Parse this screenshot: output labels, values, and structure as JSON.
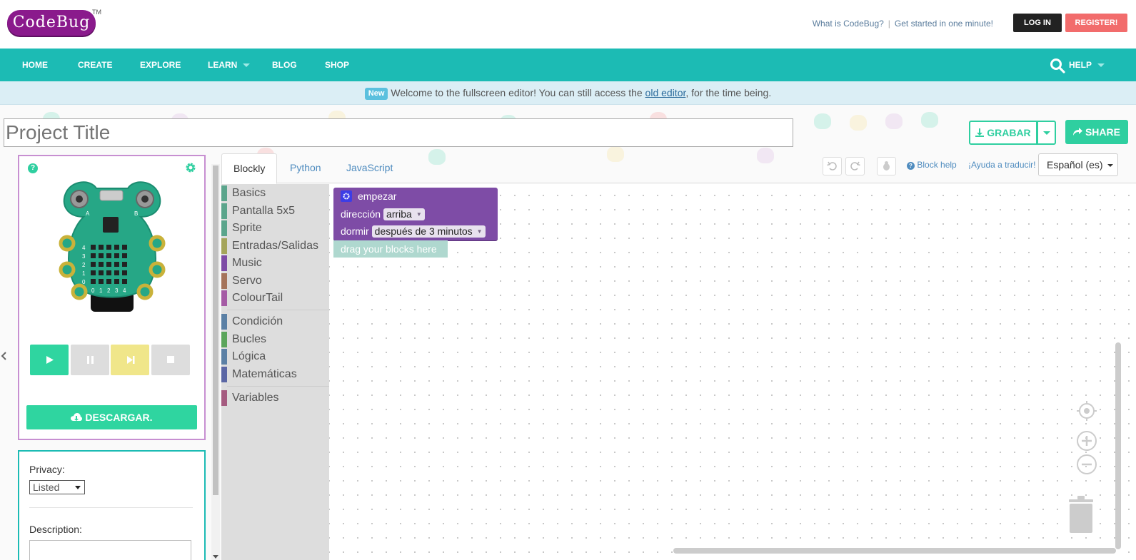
{
  "header": {
    "logo_text": "CodeBug",
    "trademark": "TM",
    "links": [
      "What is CodeBug?",
      "Get started in one minute!"
    ],
    "login_label": "LOG IN",
    "register_label": "REGISTER!"
  },
  "nav": {
    "items": [
      "HOME",
      "CREATE",
      "EXPLORE",
      "LEARN",
      "BLOG",
      "SHOP"
    ],
    "help_label": "HELP"
  },
  "banner": {
    "badge": "New",
    "text_before": "Welcome to the fullscreen editor! You can still access the ",
    "link": "old editor",
    "text_after": ", for the time being."
  },
  "project": {
    "title_placeholder": "Project Title",
    "grabar_label": "GRABAR",
    "share_label": "SHARE"
  },
  "simulator": {
    "button_a": "A",
    "button_b": "B",
    "row_labels": [
      "4",
      "3",
      "2",
      "1",
      "0"
    ],
    "col_labels": [
      "0",
      "1",
      "2",
      "3",
      "4"
    ],
    "download_label": "DESCARGAR."
  },
  "info": {
    "privacy_label": "Privacy:",
    "privacy_value": "Listed",
    "description_label": "Description:"
  },
  "editor": {
    "tabs": [
      "Blockly",
      "Python",
      "JavaScript"
    ],
    "active_tab": "Blockly",
    "block_help": "Block help",
    "ayuda": "¡Ayuda a traducir!",
    "language": "Español (es)"
  },
  "toolbox": {
    "group1": [
      {
        "label": "Basics",
        "color": "#5ba58c"
      },
      {
        "label": "Pantalla 5x5",
        "color": "#5ba58c"
      },
      {
        "label": "Sprite",
        "color": "#5ba58c"
      },
      {
        "label": "Entradas/Salidas",
        "color": "#a5a55b"
      },
      {
        "label": "Music",
        "color": "#7e4ca6"
      },
      {
        "label": "Servo",
        "color": "#a5745b"
      },
      {
        "label": "ColourTail",
        "color": "#a55ba5"
      }
    ],
    "group2": [
      {
        "label": "Condición",
        "color": "#5b80a5"
      },
      {
        "label": "Bucles",
        "color": "#5ba55b"
      },
      {
        "label": "Lógica",
        "color": "#5b80a5"
      },
      {
        "label": "Matemáticas",
        "color": "#5b67a5"
      }
    ],
    "group3": [
      {
        "label": "Variables",
        "color": "#a55b80"
      }
    ]
  },
  "workspace": {
    "block_title": "empezar",
    "direction_label": "dirección",
    "direction_value": "arriba",
    "sleep_label": "dormir",
    "sleep_value": "después de 3 minutos",
    "drag_hint": "drag your blocks here"
  },
  "colors": {
    "teal": "#1cbbb4",
    "green": "#2fcfa0",
    "purple": "#7e4ca6",
    "register": "#f26c6c"
  }
}
